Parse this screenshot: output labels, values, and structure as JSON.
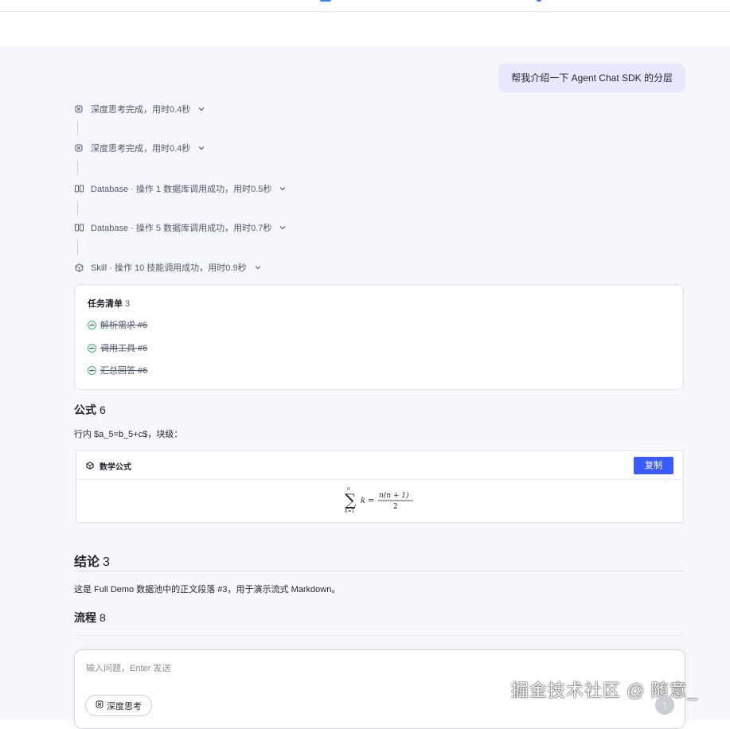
{
  "user_message": "帮我介绍一下 Agent Chat SDK 的分层",
  "steps": [
    {
      "icon": "brain-icon",
      "label": "深度思考完成，用时0.4秒"
    },
    {
      "icon": "brain-icon",
      "label": "深度思考完成，用时0.4秒"
    },
    {
      "icon": "database-icon",
      "label": "Database · 操作 1 数据库调用成功，用时0.5秒"
    },
    {
      "icon": "database-icon",
      "label": "Database · 操作 5 数据库调用成功，用时0.7秒"
    },
    {
      "icon": "skill-icon",
      "label": "Skill · 操作 10 技能调用成功，用时0.9秒"
    }
  ],
  "task_list": {
    "title": "任务清单",
    "count": "3",
    "items": [
      "解析需求 #6",
      "调用工具 #6",
      "汇总回答 #6"
    ]
  },
  "formula_section": {
    "heading": "公式",
    "heading_num": "6",
    "paragraph": "行内 $a_5=b_5+c$，块级："
  },
  "math_block": {
    "title": "数学公式",
    "copy_label": "复制",
    "formula": "∑_{k=1}^{n} k = n(n+1)/2"
  },
  "conclusion": {
    "heading": "结论",
    "heading_num": "3",
    "paragraph": "这是 Full Demo 数据池中的正文段落 #3，用于演示流式 Markdown。"
  },
  "flow": {
    "heading": "流程",
    "heading_num": "8"
  },
  "composer": {
    "placeholder": "输入问题，Enter 发送",
    "deep_think_label": "深度思考"
  },
  "watermark": "掘金技术社区 @ 随意_",
  "colors": {
    "accent": "#3b5bff",
    "user_bubble": "#e6e9fb",
    "success": "#3cb371"
  }
}
